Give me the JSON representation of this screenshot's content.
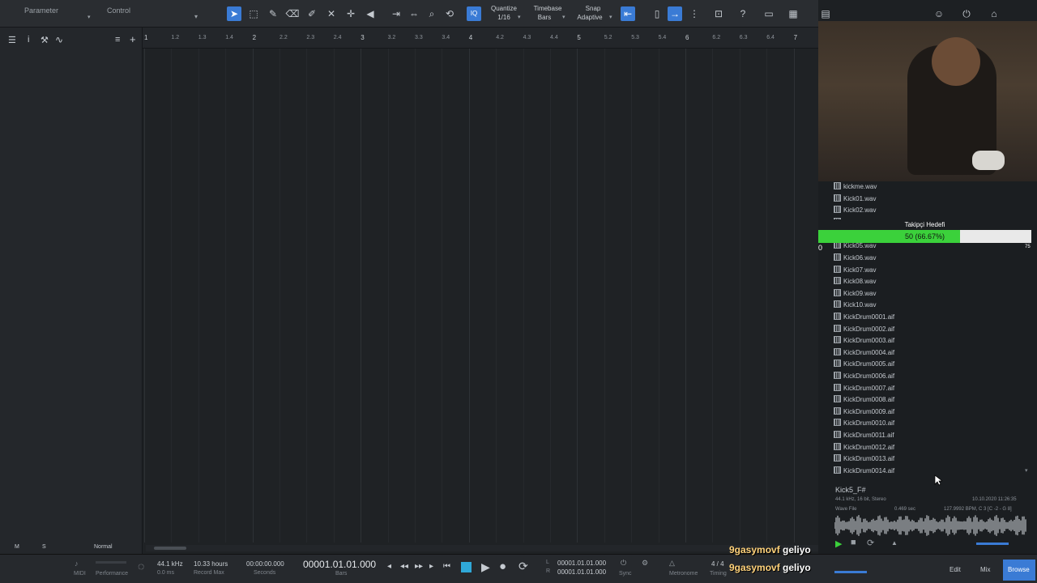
{
  "toolbar": {
    "parameter_label": "Parameter",
    "control_label": "Control",
    "quantize_label": "Quantize",
    "quantize_value": "1/16",
    "timebase_label": "Timebase",
    "timebase_value": "Bars",
    "snap_label": "Snap",
    "snap_value": "Adaptive",
    "iq_label": "IQ"
  },
  "ruler": {
    "ticks": [
      "1",
      "1.2",
      "1.3",
      "1.4",
      "2",
      "2.2",
      "2.3",
      "2.4",
      "3",
      "3.2",
      "3.3",
      "3.4",
      "4",
      "4.2",
      "4.3",
      "4.4",
      "5",
      "5.2",
      "5.3",
      "5.4",
      "6",
      "6.2",
      "6.3",
      "6.4",
      "7"
    ]
  },
  "left_panel": {
    "m_label": "M",
    "s_label": "S",
    "mode_label": "Normal"
  },
  "browser": {
    "files": [
      "kickme.wav",
      "Kick01.wav",
      "Kick02.wav",
      "Kick03.wav",
      "Kick05.wav",
      "Kick06.wav",
      "Kick07.wav",
      "Kick08.wav",
      "Kick09.wav",
      "Kick10.wav",
      "KickDrum0001.aif",
      "KickDrum0002.aif",
      "KickDrum0003.aif",
      "KickDrum0004.aif",
      "KickDrum0005.aif",
      "KickDrum0006.aif",
      "KickDrum0007.aif",
      "KickDrum0008.aif",
      "KickDrum0009.aif",
      "KickDrum0010.aif",
      "KickDrum0011.aif",
      "KickDrum0012.aif",
      "KickDrum0013.aif",
      "KickDrum0014.aif"
    ],
    "preview_name": "Kick5_F#",
    "preview_format": "44.1 kHz, 16 bit, Stereo",
    "preview_date": "10.10.2020 11:26:35",
    "preview_type": "Wave File",
    "preview_length": "0.469 sec",
    "preview_bpm": "127.9992 BPM, C 3 [C -2 - G 8]"
  },
  "follower_goal": {
    "title": "Takipçi Hedefi",
    "text": "50 (66.67%)",
    "min": "0",
    "max": "75",
    "progress": 0.6667
  },
  "transport": {
    "midi_label": "MIDI",
    "performance_label": "Performance",
    "sample_rate": "44.1 kHz",
    "latency": "0.0 ms",
    "record_time": "10.33 hours",
    "record_max_label": "Record Max",
    "time_seconds": "00:00:00.000",
    "seconds_label": "Seconds",
    "time_bars": "00001.01.01.000",
    "bars_label": "Bars",
    "loop_l": "00001.01.01.000",
    "loop_r": "00001.01.01.000",
    "l_label": "L",
    "r_label": "R",
    "sync_label": "Sync",
    "metronome_label": "Metronome",
    "signature": "4 / 4",
    "timing_label": "Timing",
    "edit_label": "Edit",
    "mix_label": "Mix",
    "browse_label": "Browse"
  },
  "chat": [
    {
      "user": "9gasymovf",
      "message": "geliyo"
    },
    {
      "user": "9gasymovf",
      "message": "geliyo"
    }
  ],
  "colors": {
    "accent": "#3a7bd5",
    "progress_green": "#3bd13b",
    "background": "#1f2225"
  }
}
